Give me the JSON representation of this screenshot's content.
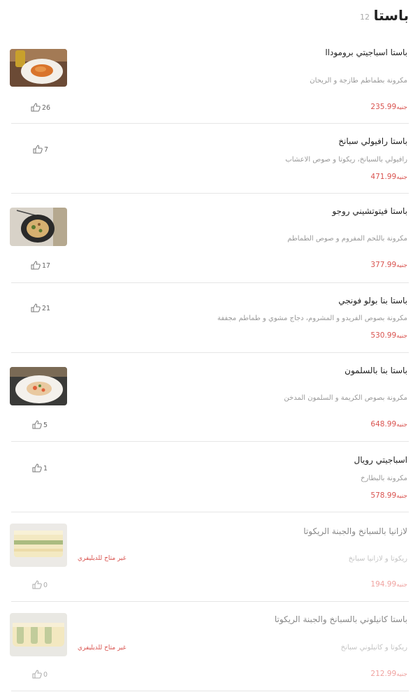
{
  "category": {
    "title": "باستا",
    "count": "12"
  },
  "currency_label": "جنيه",
  "items": [
    {
      "name": "باستا اسباجيتي بروموداا",
      "desc": "مكرونة بطماطم طازجة و الريحان",
      "price": "235.99",
      "likes": "26",
      "has_image": true,
      "available": true
    },
    {
      "name": "باستا رافيولي سبانخ",
      "desc": "رافيولي بالسبانخ، ريكوتا و صوص الاعشاب",
      "price": "471.99",
      "likes": "7",
      "has_image": false,
      "available": true
    },
    {
      "name": "باستا فيتوتشيني روجو",
      "desc": "مكرونة باللحم المفروم و صوص الطماطم",
      "price": "377.99",
      "likes": "17",
      "has_image": true,
      "available": true
    },
    {
      "name": "باستا بنا بولو فونجي",
      "desc": "مكرونة بصوص الفريدو و المشروم، دجاج مشوي و طماطم مجففة",
      "price": "530.99",
      "likes": "21",
      "has_image": false,
      "available": true
    },
    {
      "name": "باستا بنا بالسلمون",
      "desc": "مكرونة بصوص الكريمة و السلمون المدخن",
      "price": "648.99",
      "likes": "5",
      "has_image": true,
      "available": true
    },
    {
      "name": "اسباجيتي رويال",
      "desc": "مكرونة بالبطارخ",
      "price": "578.99",
      "likes": "1",
      "has_image": false,
      "available": true
    },
    {
      "name": "لازانيا بالسبانخ والجبنة الريكوتا",
      "desc": "ريكوتا و لازانيا سبانخ",
      "price": "194.99",
      "likes": "0",
      "has_image": true,
      "available": false,
      "unavailable_label": "غير متاح للديليفري"
    },
    {
      "name": "باستا كانيلوني بالسبانخ والجبنة الريكوتا",
      "desc": "ريكوتا و كانيلوني سبانخ",
      "price": "212.99",
      "likes": "0",
      "has_image": true,
      "available": false,
      "unavailable_label": "غير متاح للديليفري"
    }
  ]
}
